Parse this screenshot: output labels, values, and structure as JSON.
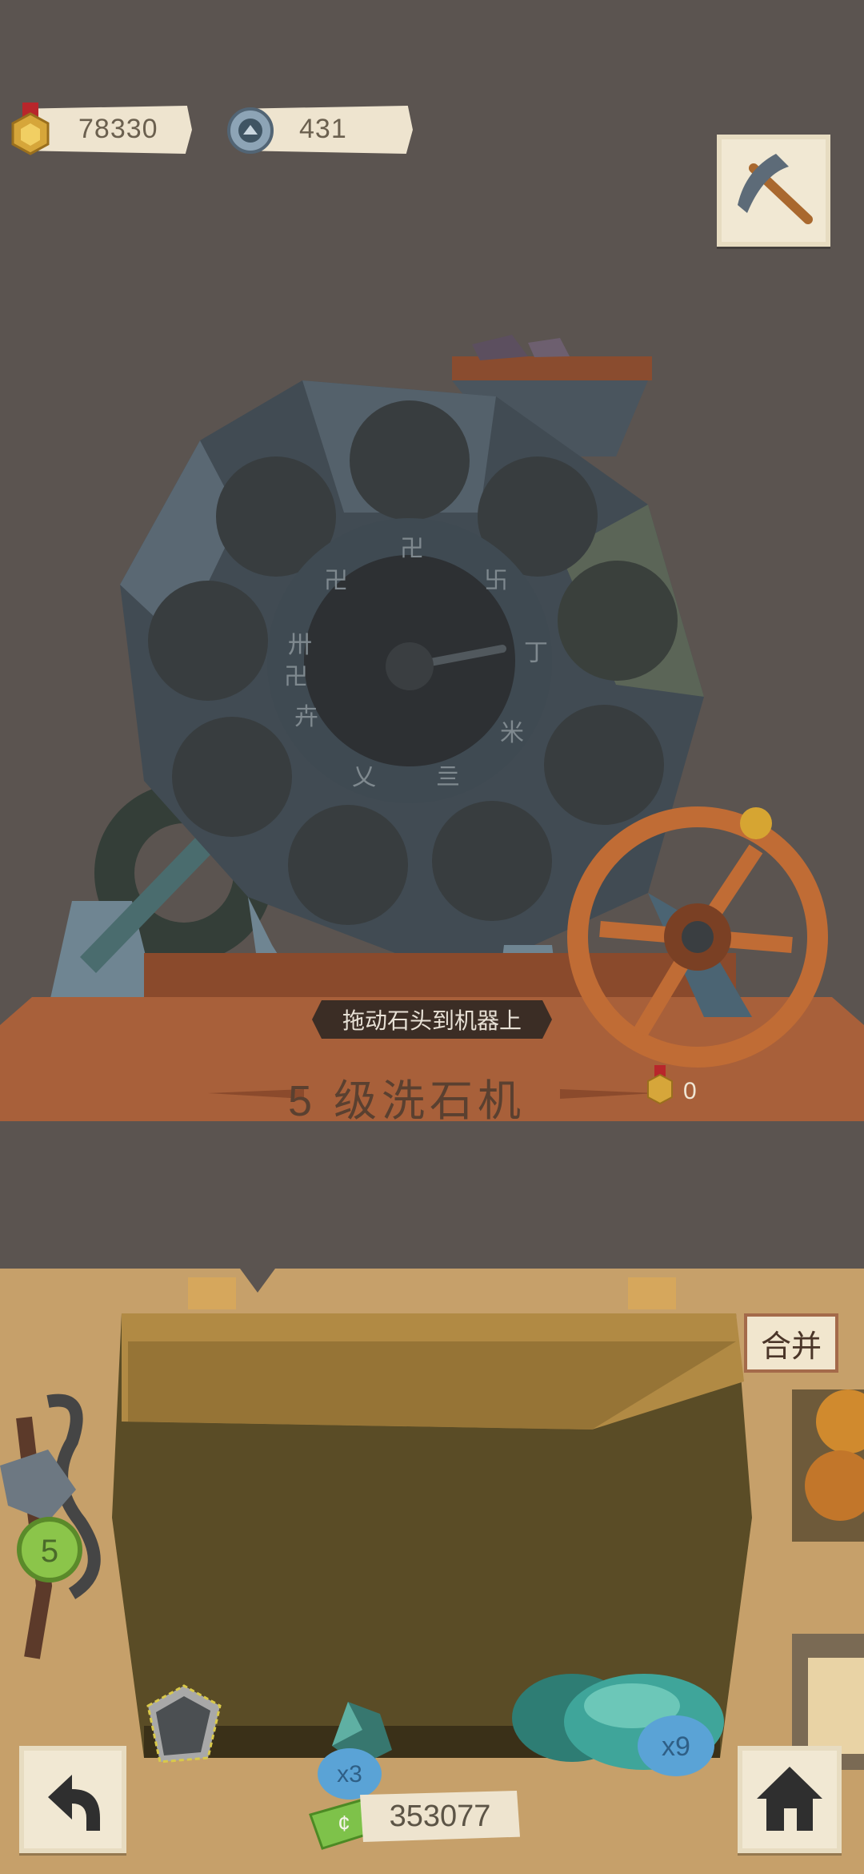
{
  "resources": {
    "gold_medals": "78330",
    "gears": "431"
  },
  "machine": {
    "hint": "拖动石头到机器上",
    "level_title": "5 级洗石机",
    "medal_count": "0",
    "dial_glyphs": [
      "卍",
      "卐",
      "卍",
      "丁",
      "卅",
      "亖",
      "乂",
      "卉",
      "米",
      "卍"
    ]
  },
  "bag": {
    "merge_label": "合并",
    "gem_count": "x3",
    "stone_count": "x9",
    "money": "353077",
    "upgrade_level": "5"
  },
  "colors": {
    "background": "#5b5450",
    "floor_wood": "#a8603a",
    "bag_panel": "#c6a06a",
    "sack": "#5a4c26",
    "machine_body": "#5a6671",
    "wheel": "#c06c35",
    "gem": "#3fa59a"
  }
}
